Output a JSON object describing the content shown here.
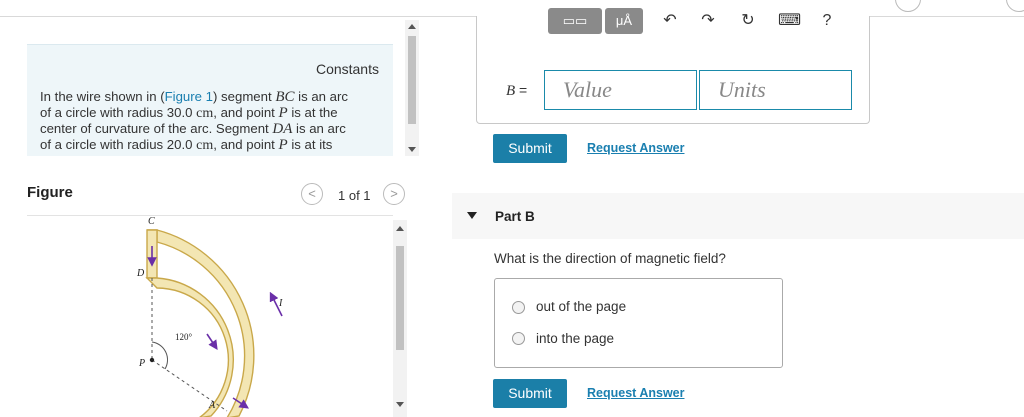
{
  "constants": {
    "title": "Constants",
    "line1_pre": "In the wire shown in (",
    "figure_link": "Figure 1",
    "line1_post": ") segment ",
    "seg1": "BC",
    "line1_end": " is an arc",
    "line2_pre": "of a circle with radius 30.0 ",
    "unit": "cm",
    "line2_mid": ", and point ",
    "point": "P",
    "line2_end": " is at the",
    "line3_pre": "center of curvature of the arc. Segment ",
    "seg2": "DA",
    "line3_end": " is an arc",
    "line4_pre": "of a circle with radius 20.0 ",
    "line4_mid": ", and point ",
    "line4_end": " is at its"
  },
  "figure": {
    "title": "Figure",
    "pager": "1 of 1",
    "prev": "<",
    "next": ">",
    "labels": {
      "c": "C",
      "d": "D",
      "p": "P",
      "a": "A",
      "i": "I",
      "angle": "120°"
    }
  },
  "part_a": {
    "toolbar": {
      "templates": "▭▭",
      "units": "μÅ",
      "undo": "↶",
      "redo": "↷",
      "reset": "↻",
      "keyboard": "⌨",
      "help": "?"
    },
    "label_var": "B",
    "label_eq": " =",
    "value_placeholder": "Value",
    "units_placeholder": "Units",
    "submit": "Submit",
    "request": "Request Answer"
  },
  "part_b": {
    "title": "Part B",
    "question": "What is the direction of magnetic field?",
    "options": [
      "out of the page",
      "into the page"
    ],
    "submit": "Submit",
    "request": "Request Answer"
  },
  "colors": {
    "accent": "#1b7fa8",
    "link": "#1a7fb0",
    "wire_fill": "#f3e6b3",
    "wire_edge": "#c9a84a",
    "arrow": "#6a2fa8"
  }
}
